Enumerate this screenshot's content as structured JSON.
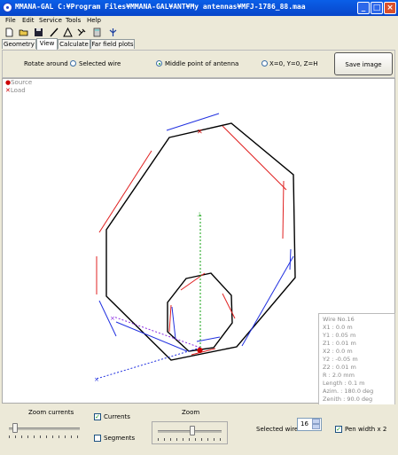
{
  "window": {
    "title": "MMANA-GAL C:¥Program Files¥MMANA-GAL¥ANT¥My antennas¥MFJ-1786_88.maa",
    "minimize": "_",
    "maximize": "□",
    "close": "×"
  },
  "menu": [
    "File",
    "Edit",
    "Service",
    "Tools",
    "Help"
  ],
  "toolbar": [
    "new-file-icon",
    "open-folder-icon",
    "save-disk-icon",
    "wire-tool-icon",
    "triangle-tool-icon",
    "tools-icon",
    "calculator-icon",
    "antenna-icon"
  ],
  "tabs": [
    {
      "label": "Geometry",
      "active": false
    },
    {
      "label": "View",
      "active": true
    },
    {
      "label": "Calculate",
      "active": false
    },
    {
      "label": "Far field plots",
      "active": false
    }
  ],
  "rotate": {
    "label": "Rotate around :",
    "options": [
      {
        "label": "Selected wire",
        "selected": false
      },
      {
        "label": "Middle point of antenna",
        "selected": true
      },
      {
        "label": "X=0, Y=0, Z=H",
        "selected": false
      }
    ],
    "save_label": "Save image"
  },
  "legend": {
    "source": "Source",
    "load": "Load",
    "source_color": "#cc0000",
    "load_color": "#cc0000"
  },
  "wire_info": {
    "title": "Wire No.16",
    "rows": [
      "X1  :  0.0 m",
      "Y1  :  0.05 m",
      "Z1  :  0.01 m",
      "X2  :  0.0 m",
      "Y2  :  -0.05 m",
      "Z2  :  0.01 m",
      "R   :  2.0 mm",
      "Length  :  0.1 m",
      "Azim.  :  180.0 deg",
      "Zenith  :  90.0 deg"
    ]
  },
  "bottom": {
    "zoom_currents_label": "Zoom currents",
    "currents_label": "Currents",
    "currents_checked": true,
    "segments_label": "Segments",
    "segments_checked": false,
    "zoom_label": "Zoom",
    "selected_wire_label": "Selected wire",
    "selected_wire_value": "16",
    "penwidth_label": "Pen width x 2",
    "penwidth_checked": true
  },
  "colors": {
    "wire": "#000000",
    "current_red": "#e02020",
    "current_blue": "#2030e0",
    "axis_green": "#10a010",
    "axis_blue": "#2030e0"
  }
}
